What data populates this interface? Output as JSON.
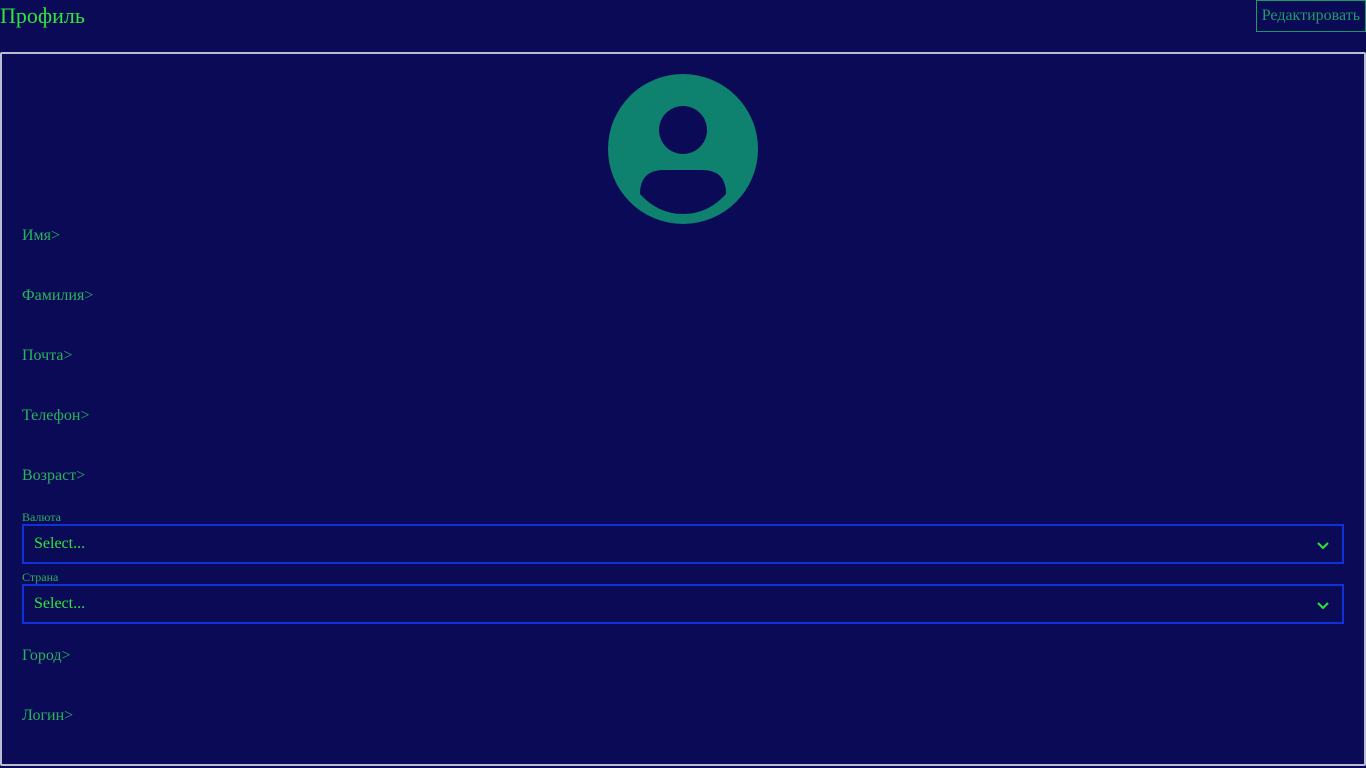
{
  "header": {
    "title": "Профиль",
    "edit_label": "Редактировать"
  },
  "profile": {
    "avatar_icon": "user-avatar-icon",
    "fields": {
      "first_name": "Имя>",
      "last_name": "Фамилия>",
      "email": "Почта>",
      "phone": "Телефон>",
      "age": "Возраст>",
      "city": "Город>",
      "login": "Логин>"
    },
    "currency": {
      "label": "Валюта",
      "value": "Select..."
    },
    "country": {
      "label": "Страна",
      "value": "Select..."
    }
  },
  "colors": {
    "background": "#0b0a57",
    "title": "#2ee53a",
    "text": "#27b45c",
    "avatar": "#0e826e",
    "select_border": "#1030d8",
    "card_border": "#bcbcd4"
  }
}
